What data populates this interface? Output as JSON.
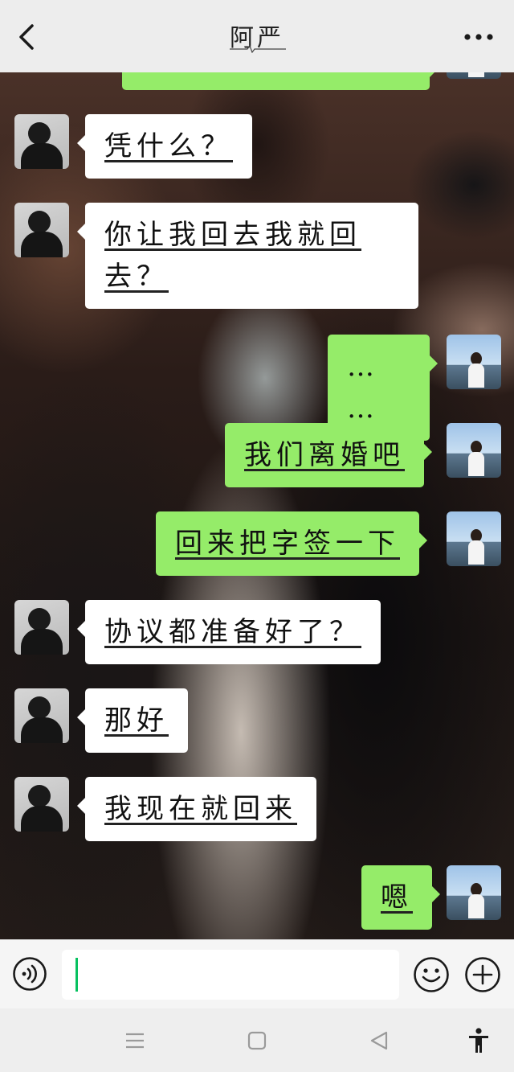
{
  "header": {
    "title": "阿严",
    "back_icon": "chevron-left-icon",
    "more_icon": "more-dots-icon"
  },
  "messages": [
    {
      "side": "right",
      "text": "",
      "partial": true
    },
    {
      "side": "left",
      "text": "凭什么？"
    },
    {
      "side": "left",
      "text": "你让我回去我就回去？"
    },
    {
      "side": "right",
      "text": "… …"
    },
    {
      "side": "right",
      "text": "我们离婚吧"
    },
    {
      "side": "right",
      "text": "回来把字签一下"
    },
    {
      "side": "left",
      "text": "协议都准备好了？"
    },
    {
      "side": "left",
      "text": "那好"
    },
    {
      "side": "left",
      "text": "我现在就回来"
    },
    {
      "side": "right",
      "text": "嗯"
    }
  ],
  "input_bar": {
    "value": "",
    "voice_icon": "voice-icon",
    "emoji_icon": "emoji-icon",
    "plus_icon": "plus-icon"
  },
  "nav_bar": {
    "menu_icon": "menu-icon",
    "home_icon": "home-square-icon",
    "back_icon": "back-triangle-icon",
    "accessibility_icon": "accessibility-icon"
  },
  "colors": {
    "outgoing_bubble": "#95ec69",
    "incoming_bubble": "#ffffff",
    "header_bg": "#ededed",
    "caret": "#07c160"
  }
}
